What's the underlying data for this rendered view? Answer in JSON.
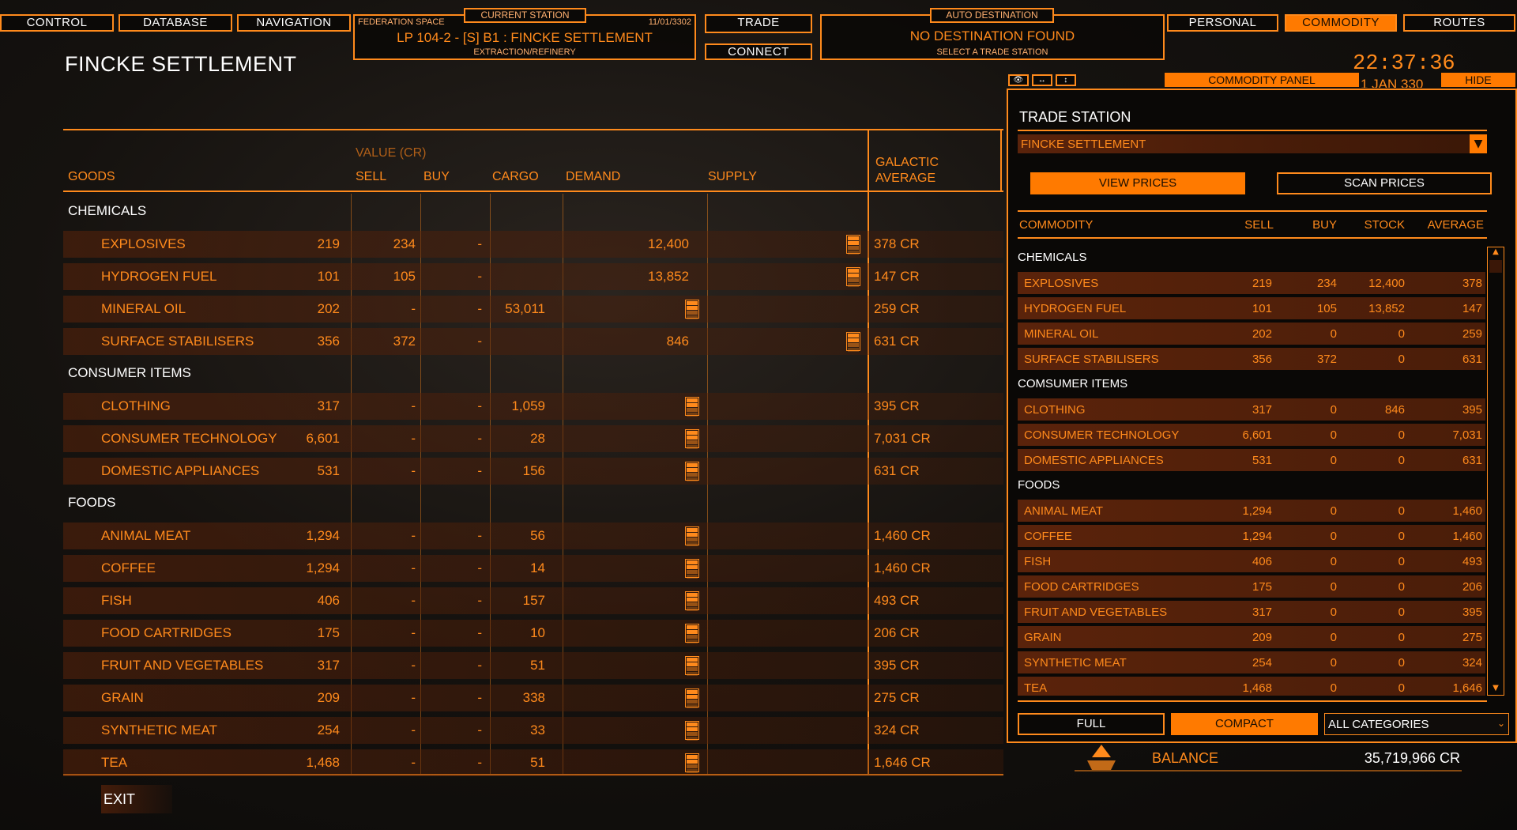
{
  "top_nav": {
    "control": "CONTROL",
    "database": "DATABASE",
    "navigation": "NAVIGATION",
    "trade": "TRADE",
    "connect": "CONNECT",
    "personal": "PERSONAL",
    "commodity": "COMMODITY",
    "routes": "ROUTES"
  },
  "station_box": {
    "tab_label": "CURRENT STATION",
    "faction": "FEDERATION SPACE",
    "date": "11/01/3302",
    "name": "LP 104-2 - [S] B1 : FINCKE SETTLEMENT",
    "economy": "EXTRACTION/REFINERY"
  },
  "auto_dest": {
    "tab_label": "AUTO DESTINATION",
    "status": "NO DESTINATION FOUND",
    "hint": "SELECT A TRADE STATION"
  },
  "clock": {
    "time": "22:37:36",
    "date": "1 JAN 330"
  },
  "page_title": "FINCKE SETTLEMENT",
  "main_table": {
    "headers": {
      "goods": "GOODS",
      "value": "VALUE (CR)",
      "sell": "SELL",
      "buy": "BUY",
      "cargo": "CARGO",
      "demand": "DEMAND",
      "supply": "SUPPLY",
      "galactic": "GALACTIC",
      "average": "AVERAGE"
    },
    "groups": [
      {
        "name": "CHEMICALS",
        "rows": [
          {
            "name": "EXPLOSIVES",
            "sell": "219",
            "buy": "234",
            "cargo": "-",
            "demand": "",
            "supply": "12,400",
            "avg": "378 CR"
          },
          {
            "name": "HYDROGEN FUEL",
            "sell": "101",
            "buy": "105",
            "cargo": "-",
            "demand": "",
            "supply": "13,852",
            "avg": "147 CR"
          },
          {
            "name": "MINERAL OIL",
            "sell": "202",
            "buy": "-",
            "cargo": "-",
            "demand": "53,011",
            "supply": "",
            "avg": "259 CR"
          },
          {
            "name": "SURFACE STABILISERS",
            "sell": "356",
            "buy": "372",
            "cargo": "-",
            "demand": "",
            "supply": "846",
            "avg": "631 CR"
          }
        ]
      },
      {
        "name": "CONSUMER ITEMS",
        "rows": [
          {
            "name": "CLOTHING",
            "sell": "317",
            "buy": "-",
            "cargo": "-",
            "demand": "1,059",
            "supply": "",
            "avg": "395 CR"
          },
          {
            "name": "CONSUMER TECHNOLOGY",
            "sell": "6,601",
            "buy": "-",
            "cargo": "-",
            "demand": "28",
            "supply": "",
            "avg": "7,031 CR"
          },
          {
            "name": "DOMESTIC APPLIANCES",
            "sell": "531",
            "buy": "-",
            "cargo": "-",
            "demand": "156",
            "supply": "",
            "avg": "631 CR"
          }
        ]
      },
      {
        "name": "FOODS",
        "rows": [
          {
            "name": "ANIMAL MEAT",
            "sell": "1,294",
            "buy": "-",
            "cargo": "-",
            "demand": "56",
            "supply": "",
            "avg": "1,460 CR"
          },
          {
            "name": "COFFEE",
            "sell": "1,294",
            "buy": "-",
            "cargo": "-",
            "demand": "14",
            "supply": "",
            "avg": "1,460 CR"
          },
          {
            "name": "FISH",
            "sell": "406",
            "buy": "-",
            "cargo": "-",
            "demand": "157",
            "supply": "",
            "avg": "493 CR"
          },
          {
            "name": "FOOD CARTRIDGES",
            "sell": "175",
            "buy": "-",
            "cargo": "-",
            "demand": "10",
            "supply": "",
            "avg": "206 CR"
          },
          {
            "name": "FRUIT AND VEGETABLES",
            "sell": "317",
            "buy": "-",
            "cargo": "-",
            "demand": "51",
            "supply": "",
            "avg": "395 CR"
          },
          {
            "name": "GRAIN",
            "sell": "209",
            "buy": "-",
            "cargo": "-",
            "demand": "338",
            "supply": "",
            "avg": "275 CR"
          },
          {
            "name": "SYNTHETIC MEAT",
            "sell": "254",
            "buy": "-",
            "cargo": "-",
            "demand": "33",
            "supply": "",
            "avg": "324 CR"
          },
          {
            "name": "TEA",
            "sell": "1,468",
            "buy": "-",
            "cargo": "-",
            "demand": "51",
            "supply": "",
            "avg": "1,646 CR"
          }
        ]
      }
    ]
  },
  "exit_label": "EXIT",
  "balance": {
    "label": "BALANCE",
    "value": "35,719,966 CR"
  },
  "commodity_panel": {
    "title": "COMMODITY PANEL",
    "hide": "HIDE",
    "heading": "TRADE STATION",
    "station_select": "FINCKE SETTLEMENT",
    "view_prices": "VIEW PRICES",
    "scan_prices": "SCAN PRICES",
    "headers": {
      "commodity": "COMMODITY",
      "sell": "SELL",
      "buy": "BUY",
      "stock": "STOCK",
      "average": "AVERAGE"
    },
    "groups": [
      {
        "name": "CHEMICALS",
        "rows": [
          {
            "name": "EXPLOSIVES",
            "sell": "219",
            "buy": "234",
            "stock": "12,400",
            "avg": "378"
          },
          {
            "name": "HYDROGEN FUEL",
            "sell": "101",
            "buy": "105",
            "stock": "13,852",
            "avg": "147"
          },
          {
            "name": "MINERAL OIL",
            "sell": "202",
            "buy": "0",
            "stock": "0",
            "avg": "259"
          },
          {
            "name": "SURFACE STABILISERS",
            "sell": "356",
            "buy": "372",
            "stock": "0",
            "avg": "631"
          }
        ]
      },
      {
        "name": "COMSUMER ITEMS",
        "rows": [
          {
            "name": "CLOTHING",
            "sell": "317",
            "buy": "0",
            "stock": "846",
            "avg": "395"
          },
          {
            "name": "CONSUMER TECHNOLOGY",
            "sell": "6,601",
            "buy": "0",
            "stock": "0",
            "avg": "7,031"
          },
          {
            "name": "DOMESTIC APPLIANCES",
            "sell": "531",
            "buy": "0",
            "stock": "0",
            "avg": "631"
          }
        ]
      },
      {
        "name": "FOODS",
        "rows": [
          {
            "name": "ANIMAL MEAT",
            "sell": "1,294",
            "buy": "0",
            "stock": "0",
            "avg": "1,460"
          },
          {
            "name": "COFFEE",
            "sell": "1,294",
            "buy": "0",
            "stock": "0",
            "avg": "1,460"
          },
          {
            "name": "FISH",
            "sell": "406",
            "buy": "0",
            "stock": "0",
            "avg": "493"
          },
          {
            "name": "FOOD CARTRIDGES",
            "sell": "175",
            "buy": "0",
            "stock": "0",
            "avg": "206"
          },
          {
            "name": "FRUIT AND VEGETABLES",
            "sell": "317",
            "buy": "0",
            "stock": "0",
            "avg": "395"
          },
          {
            "name": "GRAIN",
            "sell": "209",
            "buy": "0",
            "stock": "0",
            "avg": "275"
          },
          {
            "name": "SYNTHETIC MEAT",
            "sell": "254",
            "buy": "0",
            "stock": "0",
            "avg": "324"
          },
          {
            "name": "TEA",
            "sell": "1,468",
            "buy": "0",
            "stock": "0",
            "avg": "1,646"
          }
        ]
      }
    ],
    "full": "FULL",
    "compact": "COMPACT",
    "category_select": "ALL CATEGORIES"
  },
  "colors": {
    "accent": "#ff8a1c",
    "active": "#ff7a00",
    "row_bg": "#5a230b",
    "text_white": "#ffffff"
  }
}
